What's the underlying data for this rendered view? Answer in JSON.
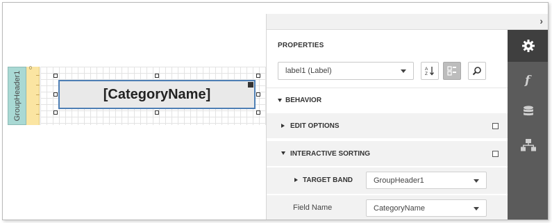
{
  "designer": {
    "band_label": "GroupHeader1",
    "ruler_zero": "0",
    "selected_control_text": "[CategoryName]"
  },
  "panel": {
    "collapse_glyph": "›",
    "section_title": "PROPERTIES",
    "selected_component": "label1 (Label)",
    "icons": {
      "sort_icon": "sort-az-icon",
      "categorized_icon": "categorized-view-icon",
      "search_icon": "search-icon"
    },
    "rail": [
      {
        "name": "properties-tab",
        "icon": "gear-icon",
        "active": true
      },
      {
        "name": "expressions-tab",
        "icon": "function-icon",
        "active": false
      },
      {
        "name": "field-list-tab",
        "icon": "database-icon",
        "active": false
      },
      {
        "name": "report-explorer-tab",
        "icon": "hierarchy-icon",
        "active": false
      }
    ],
    "groups": {
      "behavior": "BEHAVIOR",
      "edit_options": "EDIT OPTIONS",
      "interactive_sorting": "INTERACTIVE SORTING",
      "target_band": "TARGET BAND",
      "field_name": "Field Name"
    },
    "values": {
      "target_band": "GroupHeader1",
      "field_name": "CategoryName"
    }
  }
}
